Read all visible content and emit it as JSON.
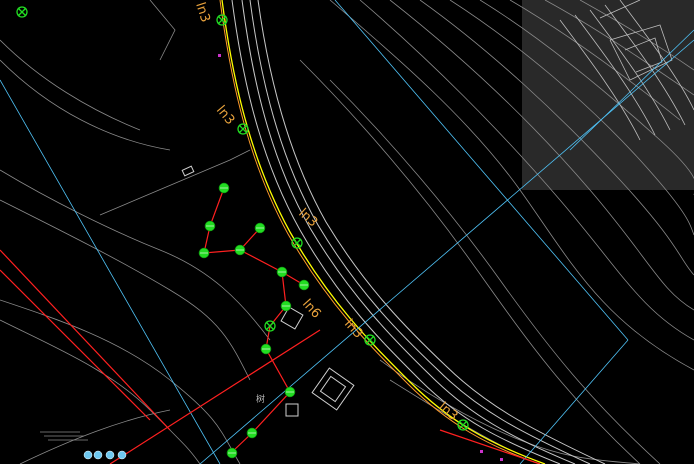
{
  "colors": {
    "background": "#000000",
    "contour": "#9a9a9a",
    "road_edge": "#c8c8c8",
    "road_centerline": "#ffff00",
    "road_offset": "#ff9a2a",
    "grid_line": "#4fc3f7",
    "symbol": "#22dd22",
    "connector": "#ff2020",
    "annotation": "#e8a23c",
    "selection_overlay": "rgba(90,90,90,0.45)",
    "magenta_marker": "#cc33cc"
  },
  "labels": {
    "ln3_top": "ln3",
    "ln3_upper": "ln3",
    "ln3_mid": "ln3",
    "ln6": "ln6",
    "ln3_lower": "ln3",
    "ln3_bottom": "ln3",
    "small_text": "树"
  },
  "icons": {
    "road_marker": "circle-cross-marker-icon",
    "tree": "tree-symbol-icon",
    "blue_symbol": "blue-dot-symbol-icon"
  }
}
